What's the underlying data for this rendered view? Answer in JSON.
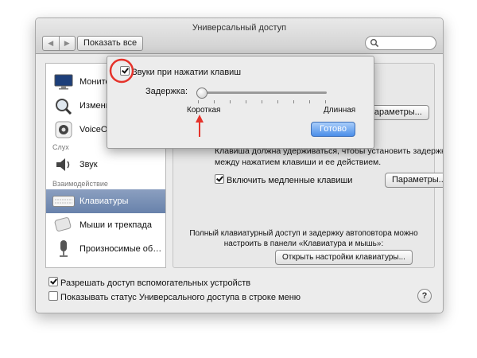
{
  "window": {
    "title": "Универсальный доступ"
  },
  "toolbar": {
    "back": "◀",
    "forward": "▶",
    "show_all": "Показать все",
    "search_placeholder": ""
  },
  "sidebar": {
    "cat_hearing": "Слух",
    "cat_interaction": "Взаимодействие",
    "items": [
      {
        "label": "Монито",
        "icon": "monitor-icon"
      },
      {
        "label": "Измени",
        "icon": "zoom-icon"
      },
      {
        "label": "VoiceOv",
        "icon": "voiceover-icon"
      },
      {
        "label": "Звук",
        "icon": "speaker-icon"
      },
      {
        "label": "Клавиатуры",
        "icon": "keyboard-icon"
      },
      {
        "label": "Мыши и трекпада",
        "icon": "mouse-icon"
      },
      {
        "label": "Произносимые об…",
        "icon": "microphone-icon"
      }
    ]
  },
  "panel": {
    "params_button_1": "Параметры...",
    "slow_keys_desc_1": "Клавиша должна удерживаться, чтобы установить задержку",
    "slow_keys_desc_2": "между нажатием клавиши и ее действием.",
    "slow_keys_label": "Включить медленные клавиши",
    "params_button_2": "Параметры...",
    "footer_text_1": "Полный клавиатурный доступ и задержку автоповтора можно",
    "footer_text_2": "настроить в панели «Клавиатура и мышь»:",
    "open_keyboard_button": "Открыть настройки клавиатуры..."
  },
  "popover": {
    "key_sounds_label": "Звуки при нажатии клавиш",
    "delay_label": "Задержка:",
    "min_label": "Короткая",
    "max_label": "Длинная",
    "done_button": "Готово",
    "delay_value": 0.0
  },
  "bottom": {
    "allow_assistive_label": "Разрешать доступ вспомогательных устройств",
    "show_status_label": "Показывать статус Универсального доступа в строке меню",
    "help_label": "?"
  },
  "colors": {
    "selected_item": "#6882ab",
    "primary_button": "#4b8ee9",
    "annotation_red": "#e5332b"
  }
}
